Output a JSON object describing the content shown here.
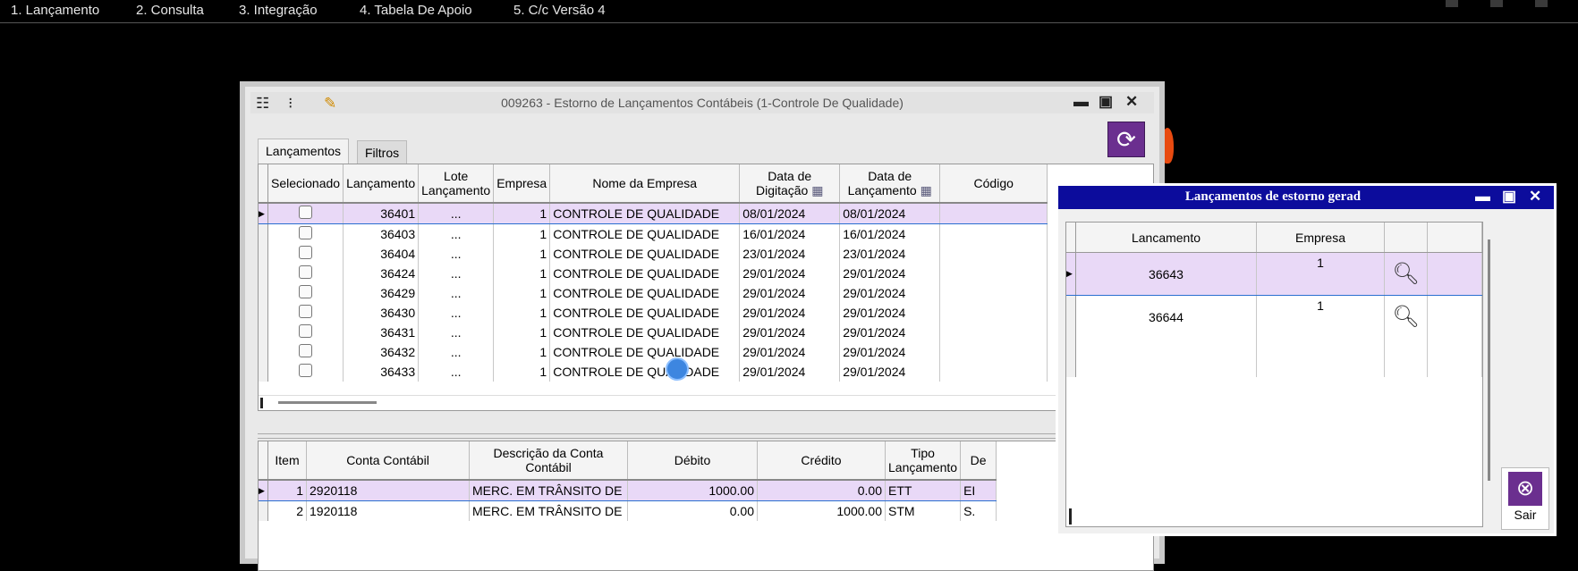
{
  "menu": [
    "1. Lançamento",
    "2. Consulta",
    "3. Integração",
    "4. Tabela De Apoio",
    "5. C/c Versão 4"
  ],
  "window": {
    "title": "009263 - Estorno de Lançamentos Contábeis (1-Controle De Qualidade)",
    "tabs": [
      "Lançamentos",
      "Filtros"
    ]
  },
  "lancamentos": {
    "headers": [
      "Selecionado",
      "Lançamento",
      "Lote Lançamento",
      "Empresa",
      "Nome da Empresa",
      "Data de Digitação",
      "Data de Lançamento",
      "Código"
    ],
    "rows": [
      {
        "lancamento": "36401",
        "lote": "...",
        "empresa": "1",
        "nome": "CONTROLE DE QUALIDADE",
        "digitacao": "08/01/2024",
        "data": "08/01/2024"
      },
      {
        "lancamento": "36403",
        "lote": "...",
        "empresa": "1",
        "nome": "CONTROLE DE QUALIDADE",
        "digitacao": "16/01/2024",
        "data": "16/01/2024"
      },
      {
        "lancamento": "36404",
        "lote": "...",
        "empresa": "1",
        "nome": "CONTROLE DE QUALIDADE",
        "digitacao": "23/01/2024",
        "data": "23/01/2024"
      },
      {
        "lancamento": "36424",
        "lote": "...",
        "empresa": "1",
        "nome": "CONTROLE DE QUALIDADE",
        "digitacao": "29/01/2024",
        "data": "29/01/2024"
      },
      {
        "lancamento": "36429",
        "lote": "...",
        "empresa": "1",
        "nome": "CONTROLE DE QUALIDADE",
        "digitacao": "29/01/2024",
        "data": "29/01/2024"
      },
      {
        "lancamento": "36430",
        "lote": "...",
        "empresa": "1",
        "nome": "CONTROLE DE QUALIDADE",
        "digitacao": "29/01/2024",
        "data": "29/01/2024"
      },
      {
        "lancamento": "36431",
        "lote": "...",
        "empresa": "1",
        "nome": "CONTROLE DE QUALIDADE",
        "digitacao": "29/01/2024",
        "data": "29/01/2024"
      },
      {
        "lancamento": "36432",
        "lote": "...",
        "empresa": "1",
        "nome": "CONTROLE DE QUALIDADE",
        "digitacao": "29/01/2024",
        "data": "29/01/2024"
      },
      {
        "lancamento": "36433",
        "lote": "...",
        "empresa": "1",
        "nome": "CONTROLE DE QUALIDADE",
        "digitacao": "29/01/2024",
        "data": "29/01/2024"
      }
    ]
  },
  "itens": {
    "headers": [
      "Item",
      "Conta Contábil",
      "Descrição da Conta Contábil",
      "Débito",
      "Crédito",
      "Tipo Lançamento",
      "De"
    ],
    "rows": [
      {
        "item": "1",
        "conta": "2920118",
        "descricao": "MERC. EM TRÂNSITO DE",
        "debito": "1000.00",
        "credito": "0.00",
        "tipo": "ETT",
        "extra": "EI"
      },
      {
        "item": "2",
        "conta": "1920118",
        "descricao": "MERC. EM TRÂNSITO DE",
        "debito": "0.00",
        "credito": "1000.00",
        "tipo": "STM",
        "extra": "S."
      }
    ]
  },
  "popup": {
    "title": "Lançamentos de estorno gerad",
    "headers": [
      "Lancamento",
      "Empresa"
    ],
    "rows": [
      {
        "lancamento": "36643",
        "empresa": "1"
      },
      {
        "lancamento": "36644",
        "empresa": "1"
      }
    ],
    "exit_label": "Sair"
  },
  "colors": {
    "accent_purple": "#6b2f8f",
    "popup_title_bg": "#0c0c9c",
    "selected_row": "#e9d9f7"
  }
}
